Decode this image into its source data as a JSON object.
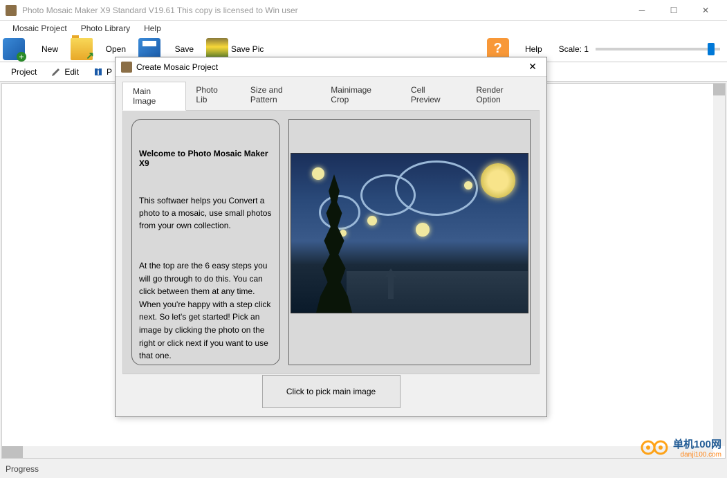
{
  "titlebar": {
    "text": "Photo Mosaic Maker X9 Standard V19.61   This copy is licensed to Win user"
  },
  "menubar": {
    "items": [
      "Mosaic Project",
      "Photo Library",
      "Help"
    ]
  },
  "toolbar": {
    "new": "New",
    "open": "Open",
    "save": "Save",
    "save_pic": "Save Pic",
    "help": "Help",
    "scale_label": "Scale: 1"
  },
  "subtoolbar": {
    "project": "Project",
    "edit": "Edit",
    "p": "P"
  },
  "statusbar": {
    "text": "Progress"
  },
  "watermark": {
    "line1": "单机100网",
    "line2": "danji100.com"
  },
  "dialog": {
    "title": "Create Mosaic Project",
    "tabs": [
      "Main Image",
      "Photo Lib",
      "Size and Pattern",
      "Mainimage Crop",
      "Cell Preview",
      "Render Option"
    ],
    "active_tab": 0,
    "welcome_title": "Welcome to Photo Mosaic Maker X9",
    "welcome_p1": "This softwaer helps you Convert a photo to a mosaic, use small photos from your own collection.",
    "welcome_p2": "At the top are the 6 easy steps you will go through to do this. You can click between them at any time. When you're happy with a step click next. So let's get started! Pick an image by clicking the photo on the right or click next if you want to use that one.",
    "pick_button": "Click to pick main image"
  }
}
